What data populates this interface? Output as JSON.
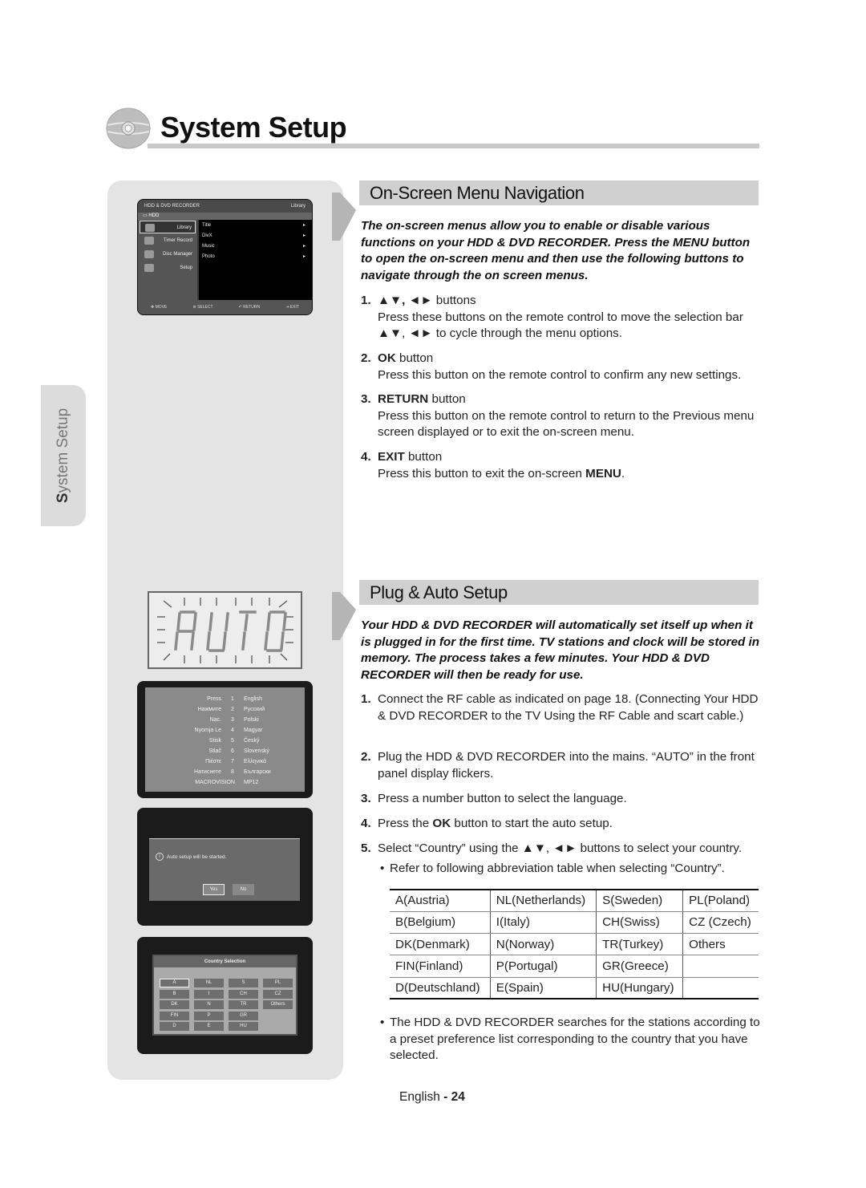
{
  "header": {
    "title": "System Setup",
    "icon": "disc-icon"
  },
  "side_tab": {
    "label_first": "S",
    "label_rest": "ystem Setup"
  },
  "screens": {
    "menu": {
      "top_left": "HDD & DVD RECORDER",
      "top_right": "Library",
      "source": "HDD",
      "left_items": [
        {
          "label": "Library",
          "icon": "library-icon",
          "selected": true
        },
        {
          "label": "Timer Record",
          "icon": "timer-record-icon",
          "selected": false
        },
        {
          "label": "Disc Manager",
          "icon": "disc-manager-icon",
          "selected": false
        },
        {
          "label": "Setup",
          "icon": "setup-icon",
          "selected": false
        }
      ],
      "options": [
        "Title",
        "DivX",
        "Music",
        "Photo"
      ],
      "option_arrow": "▸",
      "bottom": [
        "MOVE",
        "SELECT",
        "RETURN",
        "EXIT"
      ]
    },
    "lcd": {
      "text": "AUTO"
    },
    "language": {
      "rows": [
        {
          "word": "Press",
          "num": "1",
          "lang": "English"
        },
        {
          "word": "Нажмите",
          "num": "2",
          "lang": "Русский"
        },
        {
          "word": "Nac.",
          "num": "3",
          "lang": "Polski"
        },
        {
          "word": "Nyomja Le",
          "num": "4",
          "lang": "Magyar"
        },
        {
          "word": "Stisk",
          "num": "5",
          "lang": "Český"
        },
        {
          "word": "Stlač",
          "num": "6",
          "lang": "Slovenský"
        },
        {
          "word": "Πιέστε",
          "num": "7",
          "lang": "Ελληνικά"
        },
        {
          "word": "Натиснете",
          "num": "8",
          "lang": "Български"
        }
      ],
      "footer_left": "MACROVISION",
      "footer_right": "MP12"
    },
    "auto_setup": {
      "message": "Auto setup will be started.",
      "yes": "Yes",
      "no": "No",
      "icon": "info-icon"
    },
    "country_selection": {
      "title": "Country Selection",
      "grid": [
        [
          "A",
          "NL",
          "S",
          "PL"
        ],
        [
          "B",
          "I",
          "CH",
          "CZ"
        ],
        [
          "DK",
          "N",
          "TR",
          "Others"
        ],
        [
          "FIN",
          "P",
          "GR",
          ""
        ],
        [
          "D",
          "E",
          "HU",
          ""
        ]
      ],
      "selected": "A"
    }
  },
  "nav_section": {
    "title": "On-Screen Menu Navigation",
    "intro": "The on-screen menus allow you to enable or disable various functions on your HDD & DVD RECORDER. Press the MENU button to open the on-screen menu and then use the following buttons to navigate through the on screen menus.",
    "steps": [
      {
        "num": "1.",
        "head_bold": "▲▼, ◄►",
        "head": " buttons",
        "body": "Press these buttons on the remote control to move the selection bar ▲▼, ◄► to cycle through the menu options."
      },
      {
        "num": "2.",
        "head_bold": "OK",
        "head": " button",
        "body": "Press this button on the remote control to confirm any new settings."
      },
      {
        "num": "3.",
        "head_bold": "RETURN",
        "head": " button",
        "body": "Press this button on the remote control to return to the Previous menu screen displayed or to exit the on-screen menu."
      },
      {
        "num": "4.",
        "head_bold": "EXIT",
        "head": " button",
        "body_pre": "Press this button to exit the on-screen ",
        "body_bold": "MENU",
        "body_post": "."
      }
    ]
  },
  "auto_section": {
    "title": "Plug & Auto Setup",
    "intro": "Your HDD & DVD RECORDER will automatically set itself up when it is plugged in for the first time. TV stations and clock will be stored in memory. The process takes a few minutes. Your HDD & DVD RECORDER will then be ready for use.",
    "steps": [
      {
        "num": "1.",
        "text": "Connect the RF cable as indicated on page 18. (Connecting Your HDD & DVD RECORDER to the TV Using the RF Cable and scart cable.)"
      },
      {
        "num": "2.",
        "text": "Plug the HDD & DVD RECORDER into the mains. “AUTO” in the front panel display flickers."
      },
      {
        "num": "3.",
        "text": "Press a number button to select the language."
      },
      {
        "num": "4.",
        "pre": "Press the ",
        "bold": "OK",
        "post": " button to start the auto setup."
      },
      {
        "num": "5.",
        "text": "Select “Country” using the ▲▼, ◄► buttons to select your country."
      }
    ],
    "bullet_table_note": "Refer to following abbreviation table when selecting “Country”.",
    "country_table": [
      [
        "A(Austria)",
        "NL(Netherlands)",
        "S(Sweden)",
        "PL(Poland)"
      ],
      [
        "B(Belgium)",
        "I(Italy)",
        "CH(Swiss)",
        "CZ (Czech)"
      ],
      [
        "DK(Denmark)",
        "N(Norway)",
        "TR(Turkey)",
        "Others"
      ],
      [
        "FIN(Finland)",
        "P(Portugal)",
        "GR(Greece)",
        ""
      ],
      [
        "D(Deutschland)",
        "E(Spain)",
        "HU(Hungary)",
        ""
      ]
    ],
    "bullet_final": "The HDD & DVD RECORDER searches for the stations according to a preset preference list corresponding to the country that you have selected."
  },
  "footer": {
    "language": "English",
    "separator": " - ",
    "page": "24"
  }
}
